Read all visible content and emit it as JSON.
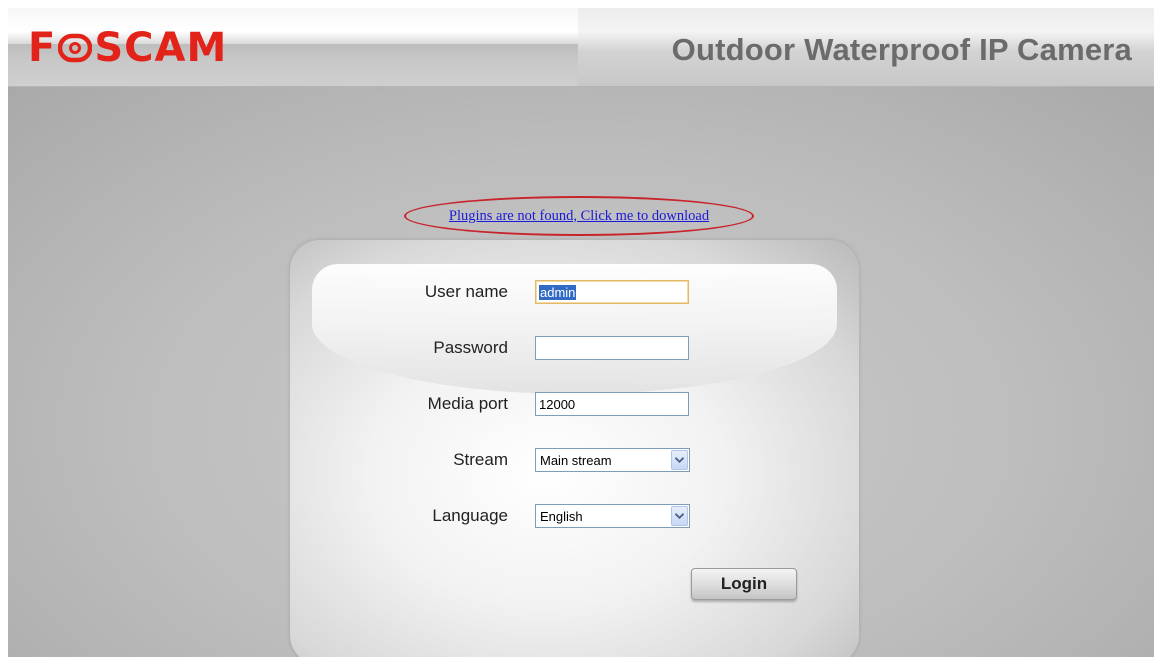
{
  "header": {
    "logo_left": "F",
    "logo_right": "SCAM",
    "title": "Outdoor Waterproof IP Camera"
  },
  "plugin_notice": {
    "link_text": "Plugins are not found, Click me to download"
  },
  "login_form": {
    "username": {
      "label": "User name",
      "value": "admin",
      "selected": true
    },
    "password": {
      "label": "Password",
      "value": ""
    },
    "media_port": {
      "label": "Media port",
      "value": "12000"
    },
    "stream": {
      "label": "Stream",
      "selected": "Main stream"
    },
    "language": {
      "label": "Language",
      "selected": "English"
    },
    "login_button": "Login"
  },
  "colors": {
    "logo_red": "#e2231a",
    "link_blue": "#1a1ad8",
    "highlight_ellipse": "#c8242b",
    "selection_blue": "#316ac5",
    "header_title_gray": "#6b6b6b"
  },
  "icons": {
    "logo_o": "foscam-o-logo-icon",
    "dropdown": "chevron-down-icon"
  }
}
